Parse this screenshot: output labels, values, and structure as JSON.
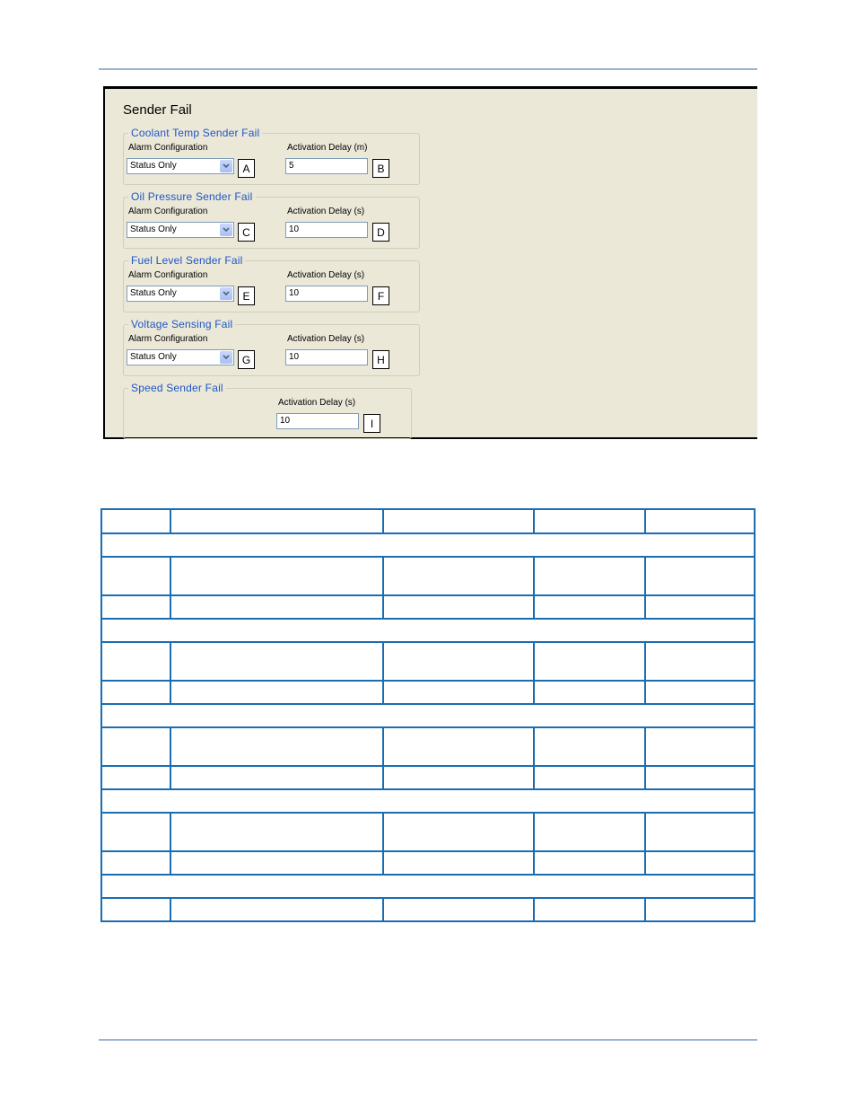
{
  "panel": {
    "title": "Sender Fail",
    "groups": [
      {
        "title": "Coolant Temp Sender Fail",
        "alarm_label": "Alarm Configuration",
        "alarm_value": "Status Only",
        "alarm_callout": "A",
        "delay_label": "Activation Delay (m)",
        "delay_value": "5",
        "delay_callout": "B"
      },
      {
        "title": "Oil Pressure Sender Fail",
        "alarm_label": "Alarm Configuration",
        "alarm_value": "Status Only",
        "alarm_callout": "C",
        "delay_label": "Activation Delay (s)",
        "delay_value": "10",
        "delay_callout": "D"
      },
      {
        "title": "Fuel Level Sender Fail",
        "alarm_label": "Alarm Configuration",
        "alarm_value": "Status Only",
        "alarm_callout": "E",
        "delay_label": "Activation Delay (s)",
        "delay_value": "10",
        "delay_callout": "F"
      },
      {
        "title": "Voltage Sensing Fail",
        "alarm_label": "Alarm Configuration",
        "alarm_value": "Status Only",
        "alarm_callout": "G",
        "delay_label": "Activation Delay (s)",
        "delay_value": "10",
        "delay_callout": "H"
      },
      {
        "title": "Speed Sender Fail",
        "delay_label": "Activation Delay (s)",
        "delay_value": "10",
        "delay_callout": "I"
      }
    ]
  },
  "table": {
    "header": [
      "",
      "",
      "",
      "",
      ""
    ],
    "sections": [
      {
        "title": "",
        "rows": [
          [
            "",
            "",
            "",
            "",
            ""
          ],
          [
            "",
            "",
            "",
            "",
            ""
          ]
        ]
      },
      {
        "title": "",
        "rows": [
          [
            "",
            "",
            "",
            "",
            ""
          ],
          [
            "",
            "",
            "",
            "",
            ""
          ]
        ]
      },
      {
        "title": "",
        "rows": [
          [
            "",
            "",
            "",
            "",
            ""
          ],
          [
            "",
            "",
            "",
            "",
            ""
          ]
        ]
      },
      {
        "title": "",
        "rows": [
          [
            "",
            "",
            "",
            "",
            ""
          ],
          [
            "",
            "",
            "",
            "",
            ""
          ]
        ]
      },
      {
        "title": "",
        "rows": [
          [
            "",
            "",
            "",
            "",
            ""
          ]
        ]
      }
    ]
  }
}
